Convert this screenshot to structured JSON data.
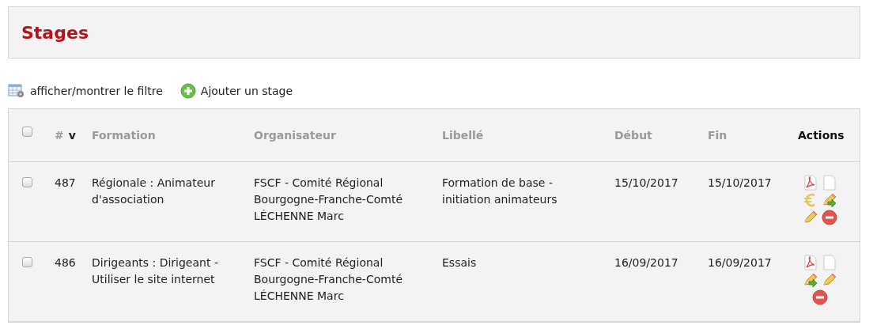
{
  "page_title": "Stages",
  "toolbar": [
    {
      "kind": "filter",
      "label": "afficher/montrer le filtre"
    },
    {
      "kind": "add",
      "label": "Ajouter un stage"
    }
  ],
  "table": {
    "select_all": {
      "checked": false
    },
    "columns": [
      {
        "label": "#",
        "sortable": true,
        "sort_indicator": "v"
      },
      {
        "label": "Formation",
        "sortable": true
      },
      {
        "label": "Organisateur",
        "sortable": true
      },
      {
        "label": "Libellé",
        "sortable": true
      },
      {
        "label": "Début",
        "sortable": true
      },
      {
        "label": "Fin",
        "sortable": true
      },
      {
        "label": "Actions",
        "sortable": false
      }
    ],
    "rows": [
      {
        "checked": false,
        "id": "487",
        "formation": "Régionale : Animateur d'association",
        "organizer": "FSCF - Comité Régional Bourgogne-Franche-Comté",
        "contact": "LÉCHENNE Marc",
        "label": "Formation de base - initiation animateurs",
        "start": "15/10/2017",
        "end": "15/10/2017",
        "actions": [
          {
            "kind": "pdf"
          },
          {
            "kind": "document"
          },
          {
            "kind": "euro"
          },
          {
            "kind": "edit-transfer"
          },
          {
            "kind": "edit"
          },
          {
            "kind": "delete"
          }
        ]
      },
      {
        "checked": false,
        "id": "486",
        "formation": "Dirigeants : Dirigeant - Utiliser le site internet",
        "organizer": "FSCF - Comité Régional Bourgogne-Franche-Comté",
        "contact": "LÉCHENNE Marc",
        "label": "Essais",
        "start": "16/09/2017",
        "end": "16/09/2017",
        "actions": [
          {
            "kind": "pdf"
          },
          {
            "kind": "document"
          },
          {
            "kind": "edit-transfer"
          },
          {
            "kind": "edit"
          },
          {
            "kind": "delete"
          }
        ]
      }
    ]
  }
}
